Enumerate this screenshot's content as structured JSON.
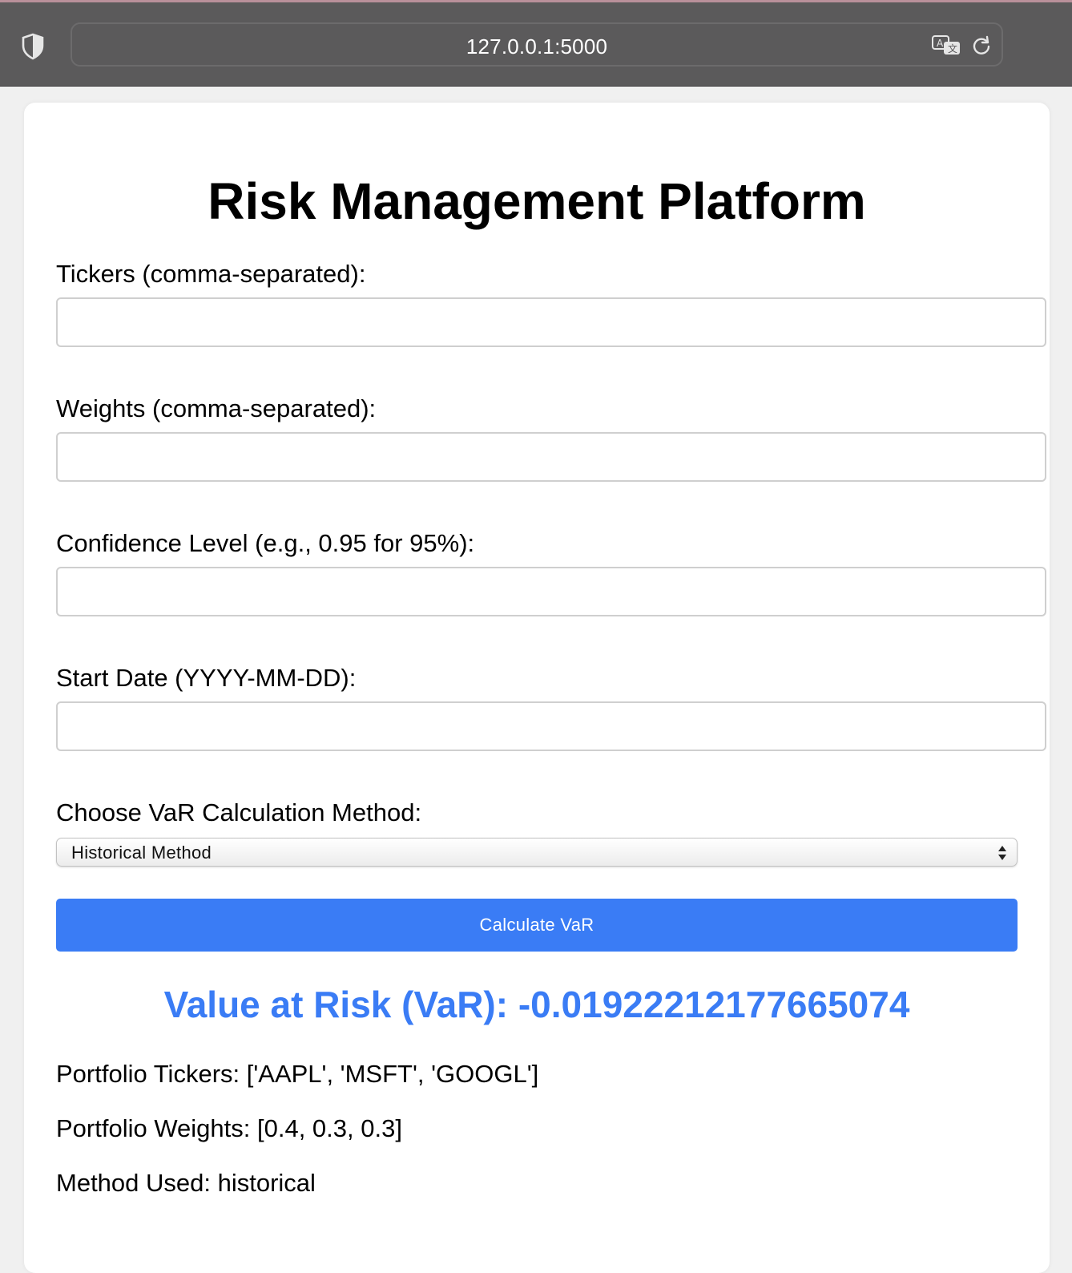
{
  "browser": {
    "url": "127.0.0.1:5000"
  },
  "page": {
    "title": "Risk Management Platform"
  },
  "form": {
    "tickers_label": "Tickers (comma-separated):",
    "tickers_value": "",
    "weights_label": "Weights (comma-separated):",
    "weights_value": "",
    "confidence_label": "Confidence Level (e.g., 0.95 for 95%):",
    "confidence_value": "",
    "start_date_label": "Start Date (YYYY-MM-DD):",
    "start_date_value": "",
    "method_label": "Choose VaR Calculation Method:",
    "method_selected": "Historical Method",
    "submit_label": "Calculate VaR"
  },
  "result": {
    "var_text": "Value at Risk (VaR): -0.019222121776650​74",
    "tickers_text": "Portfolio Tickers: ['AAPL', 'MSFT', 'GOOGL']",
    "weights_text": "Portfolio Weights: [0.4, 0.3, 0.3]",
    "method_text": "Method Used: historical"
  },
  "colors": {
    "accent": "#3a7cf5",
    "browser_bar": "#5b5a5b"
  }
}
